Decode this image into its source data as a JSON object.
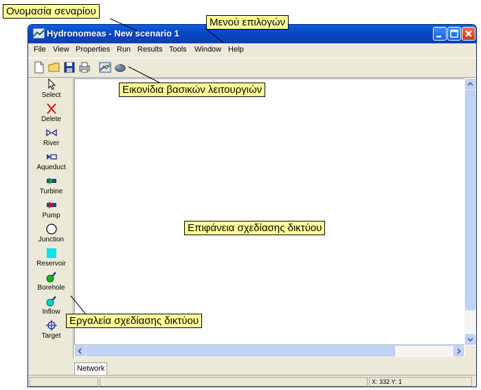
{
  "window": {
    "title": "Hydronomeas - New scenario 1"
  },
  "menu": [
    "File",
    "View",
    "Properties",
    "Run",
    "Results",
    "Tools",
    "Window",
    "Help"
  ],
  "toolbar": {
    "icons": [
      "new-file-icon",
      "open-folder-icon",
      "save-icon",
      "print-icon",
      "network-graph-icon",
      "cloud-icon"
    ]
  },
  "palette": [
    {
      "label": "Select",
      "icon": "cursor-arrow-icon"
    },
    {
      "label": "Delete",
      "icon": "delete-x-icon"
    },
    {
      "label": "River",
      "icon": "river-icon"
    },
    {
      "label": "Aqueduct",
      "icon": "aqueduct-icon"
    },
    {
      "label": "Turbine",
      "icon": "turbine-icon"
    },
    {
      "label": "Pump",
      "icon": "pump-icon"
    },
    {
      "label": "Junction",
      "icon": "junction-circle-icon"
    },
    {
      "label": "Reservoir",
      "icon": "reservoir-square-icon"
    },
    {
      "label": "Borehole",
      "icon": "borehole-icon"
    },
    {
      "label": "Inflow",
      "icon": "inflow-icon"
    },
    {
      "label": "Target",
      "icon": "target-icon"
    }
  ],
  "tabs": [
    "Network"
  ],
  "status": {
    "coords": "X: 332 Y: 1"
  },
  "callouts": {
    "scenario_name": "Ονομασία σεναρίου",
    "options_menu": "Μενού επιλογών",
    "toolbar_icons": "Εικονίδια βασικών λειτουργιών",
    "drawing_surface": "Επιφάνεια σχεδίασης δικτύου",
    "drawing_tools": "Εργαλεία σχεδίασης δικτύου"
  },
  "colors": {
    "titlebar": "#0a4fd0",
    "callout_bg": "#ffff99",
    "reservoir": "#00e5e5",
    "river": "#2b3a9a",
    "turbine": "#1d9a2e",
    "pump": "#d01010"
  }
}
